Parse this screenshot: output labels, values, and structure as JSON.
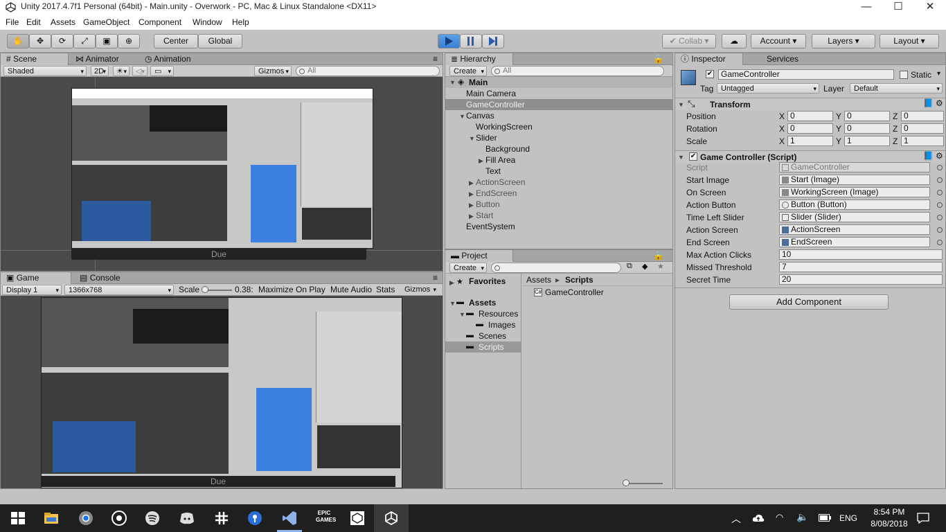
{
  "window": {
    "title": "Unity 2017.4.7f1 Personal (64bit) - Main.unity - Overwork - PC, Mac & Linux Standalone <DX11>",
    "minimize": "—",
    "maximize": "☐",
    "close": "✕"
  },
  "menu": [
    "File",
    "Edit",
    "Assets",
    "GameObject",
    "Component",
    "Window",
    "Help"
  ],
  "toolbar": {
    "center": "Center",
    "global": "Global",
    "collab": "Collab",
    "account": "Account",
    "layers": "Layers",
    "layout": "Layout"
  },
  "scene": {
    "tabs": [
      "Scene",
      "Animator",
      "Animation"
    ],
    "shading": "Shaded",
    "mode2d": "2D",
    "gizmos": "Gizmos",
    "search_placeholder": "All",
    "due": "Due"
  },
  "game": {
    "tabs": [
      "Game",
      "Console"
    ],
    "display": "Display 1",
    "resolution": "1366x768",
    "scale_label": "Scale",
    "scale_value": "0.38:",
    "maximize": "Maximize On Play",
    "mute": "Mute Audio",
    "stats": "Stats",
    "gizmos": "Gizmos",
    "due": "Due"
  },
  "hierarchy": {
    "tab": "Hierarchy",
    "create": "Create",
    "search_placeholder": "All",
    "scene": "Main",
    "items": [
      "Main Camera",
      "GameController",
      "Canvas",
      "WorkingScreen",
      "Slider",
      "Background",
      "Fill Area",
      "Text",
      "ActionScreen",
      "EndScreen",
      "Button",
      "Start",
      "EventSystem"
    ]
  },
  "project": {
    "tab": "Project",
    "create": "Create",
    "favorites": "Favorites",
    "assets": "Assets",
    "folders": [
      "Resources",
      "Images",
      "Scenes",
      "Scripts"
    ],
    "breadcrumb_root": "Assets",
    "breadcrumb_sep": "▸",
    "breadcrumb_leaf": "Scripts",
    "files": [
      "GameController"
    ]
  },
  "inspector": {
    "tabs": [
      "Inspector",
      "Services"
    ],
    "object_name": "GameController",
    "static": "Static",
    "tag_label": "Tag",
    "tag": "Untagged",
    "layer_label": "Layer",
    "layer": "Default",
    "transform": {
      "title": "Transform",
      "rows": [
        {
          "label": "Position",
          "x": "0",
          "y": "0",
          "z": "0"
        },
        {
          "label": "Rotation",
          "x": "0",
          "y": "0",
          "z": "0"
        },
        {
          "label": "Scale",
          "x": "1",
          "y": "1",
          "z": "1"
        }
      ]
    },
    "script": {
      "title": "Game Controller (Script)",
      "fields": [
        {
          "label": "Script",
          "value": "GameController"
        },
        {
          "label": "Start Image",
          "value": "Start (Image)"
        },
        {
          "label": "On Screen",
          "value": "WorkingScreen (Image)"
        },
        {
          "label": "Action Button",
          "value": "Button (Button)"
        },
        {
          "label": "Time Left Slider",
          "value": "Slider (Slider)"
        },
        {
          "label": "Action Screen",
          "value": "ActionScreen"
        },
        {
          "label": "End Screen",
          "value": "EndScreen"
        },
        {
          "label": "Max Action Clicks",
          "value": "10"
        },
        {
          "label": "Missed Threshold",
          "value": "7"
        },
        {
          "label": "Secret Time",
          "value": "20"
        }
      ]
    },
    "add_component": "Add Component"
  },
  "taskbar": {
    "language": "ENG",
    "time": "8:54 PM",
    "date": "8/08/2018",
    "epic": "EPIC\nGAMES"
  },
  "colors": {
    "accent": "#3b7fd1",
    "taskbar": "#1f1f1f"
  }
}
